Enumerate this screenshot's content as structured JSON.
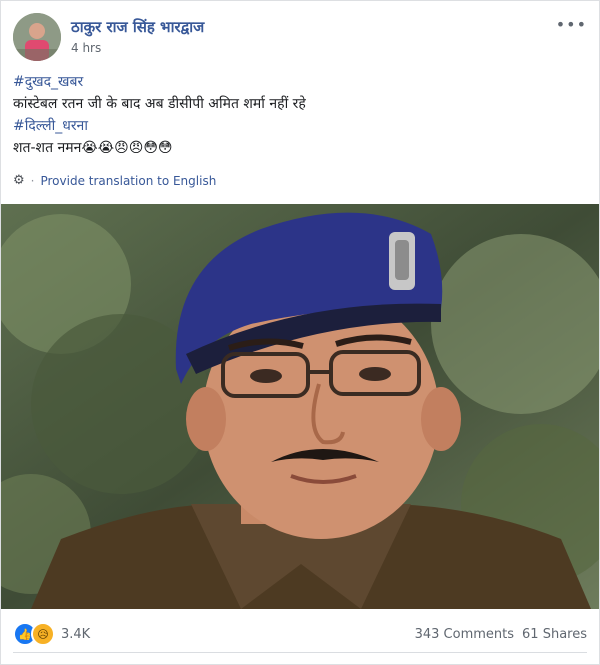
{
  "post": {
    "author": "ठाकुर राज सिंह भारद्वाज",
    "timestamp": "4 hrs",
    "more_label": "•••",
    "lines": {
      "hashtag1": "#दुखद_खबर",
      "line2": "कांस्टेबल रतन जी के बाद अब डीसीपी अमित शर्मा नहीं रहे",
      "hashtag2": "#दिल्ली_धरना",
      "line4_text": "शत-शत नमन",
      "line4_emojis": "😭😭😠😠😳😳"
    },
    "translation_label": "Provide translation to English",
    "separator": "·"
  },
  "footer": {
    "reaction_count": "3.4K",
    "comments": "343 Comments",
    "shares": "61 Shares"
  },
  "colors": {
    "link": "#385898",
    "like": "#1877f2",
    "sad": "#f7b125"
  },
  "icons": [
    "gear-icon",
    "like-icon",
    "sad-reaction-icon",
    "more-icon"
  ]
}
